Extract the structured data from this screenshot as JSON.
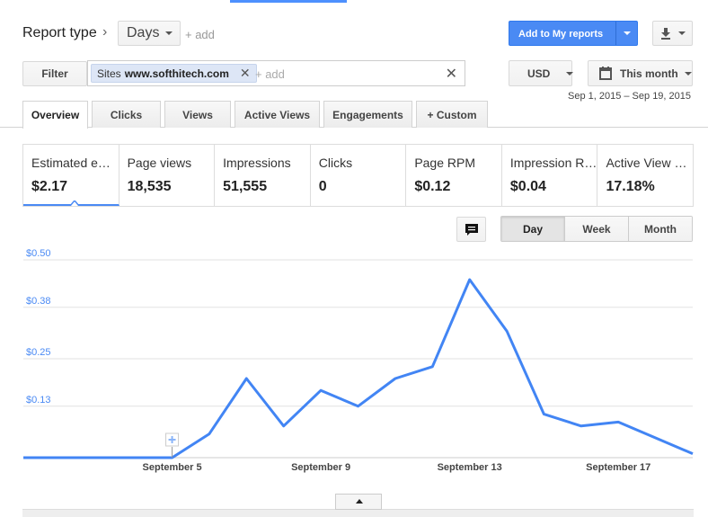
{
  "header": {
    "report_type_label": "Report type",
    "dimension_value": "Days",
    "add_label": "+ add",
    "add_to_reports_label": "Add to My reports"
  },
  "filter": {
    "button_label": "Filter",
    "chip_prefix": "Sites",
    "chip_value": "www.softhitech.com",
    "add_placeholder": "+ add"
  },
  "currency": "USD",
  "date_picker": {
    "label": "This month",
    "range": "Sep 1, 2015 – Sep 19, 2015"
  },
  "tabs": [
    {
      "label": "Overview",
      "active": true
    },
    {
      "label": "Clicks"
    },
    {
      "label": "Views"
    },
    {
      "label": "Active Views"
    },
    {
      "label": "Engagements"
    },
    {
      "label": "+ Custom"
    }
  ],
  "metrics": [
    {
      "label": "Estimated e…",
      "value": "$2.17",
      "selected": true
    },
    {
      "label": "Page views",
      "value": "18,535"
    },
    {
      "label": "Impressions",
      "value": "51,555"
    },
    {
      "label": "Clicks",
      "value": "0"
    },
    {
      "label": "Page RPM",
      "value": "$0.12"
    },
    {
      "label": "Impression R…",
      "value": "$0.04"
    },
    {
      "label": "Active View …",
      "value": "17.18%"
    }
  ],
  "granularity": {
    "options": [
      "Day",
      "Week",
      "Month"
    ],
    "selected": "Day"
  },
  "icons": {
    "chevron": "chevron-right-icon",
    "download": "download-icon",
    "calendar": "calendar-icon",
    "annotation": "comment-icon",
    "close": "close-icon",
    "collapse": "collapse-up-icon"
  },
  "colors": {
    "accent": "#4a8af4",
    "line": "#4285f4",
    "axis_label": "#4a8af4"
  },
  "chart_data": {
    "type": "line",
    "x": [
      1,
      2,
      3,
      4,
      5,
      6,
      7,
      8,
      9,
      10,
      11,
      12,
      13,
      14,
      15,
      16,
      17,
      18,
      19
    ],
    "x_tick_labels": [
      {
        "x": 5,
        "label": "September 5"
      },
      {
        "x": 9,
        "label": "September 9"
      },
      {
        "x": 13,
        "label": "September 13"
      },
      {
        "x": 17,
        "label": "September 17"
      }
    ],
    "y_ticks": [
      0.13,
      0.25,
      0.38,
      0.5
    ],
    "y_tick_labels": [
      "$0.13",
      "$0.25",
      "$0.38",
      "$0.50"
    ],
    "ylim": [
      0,
      0.5
    ],
    "series": [
      {
        "values": [
          0,
          0,
          0,
          0,
          0,
          0.06,
          0.2,
          0.08,
          0.17,
          0.13,
          0.2,
          0.23,
          0.45,
          0.32,
          0.11,
          0.08,
          0.09,
          0.05,
          0.01
        ]
      }
    ],
    "grid": true,
    "annotation_marker_x": 5
  }
}
